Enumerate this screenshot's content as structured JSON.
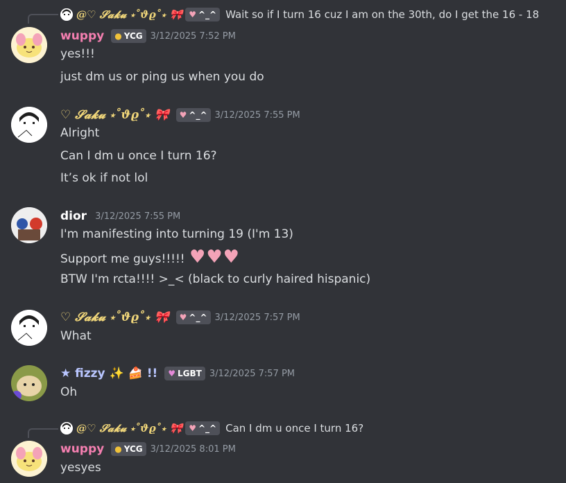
{
  "messages": [
    {
      "reply": {
        "author": "@♡ 𝓢𝓪𝓴𝓾 ⋆˚ϑϱ˚⋆ 🎀",
        "tag": "^_^",
        "text": "Wait so if I turn 16 cuz I am on the 30th, do I get the 16 - 18"
      },
      "author": "wuppy",
      "tag": "YCG",
      "timestamp": "3/12/2025 7:52 PM",
      "lines": [
        "yes!!!",
        "just dm us or ping us when you do"
      ]
    },
    {
      "author": "♡ 𝓢𝓪𝓴𝓾 ⋆˚ϑϱ˚⋆ 🎀",
      "tag": "^_^",
      "timestamp": "3/12/2025 7:55 PM",
      "lines": [
        "Alright",
        "Can I dm u once I turn 16?",
        "It’s ok if not lol"
      ]
    },
    {
      "author": "dior",
      "timestamp": "3/12/2025 7:55 PM",
      "lines": [
        "I'm manifesting into turning 19 (I'm 13)",
        "Support me guys!!!!!",
        "BTW I'm rcta!!!! >_< (black to curly haired hispanic)"
      ]
    },
    {
      "author": "♡ 𝓢𝓪𝓴𝓾 ⋆˚ϑϱ˚⋆ 🎀",
      "tag": "^_^",
      "timestamp": "3/12/2025 7:57 PM",
      "lines": [
        "What"
      ]
    },
    {
      "author": "★ fizzy ✨ 🍰 !!",
      "tag": "LGBT",
      "timestamp": "3/12/2025 7:57 PM",
      "lines": [
        "Oh"
      ]
    },
    {
      "reply": {
        "author": "@♡ 𝓢𝓪𝓴𝓾 ⋆˚ϑϱ˚⋆ 🎀",
        "tag": "^_^",
        "text": "Can I dm u once I turn 16?"
      },
      "author": "wuppy",
      "tag": "YCG",
      "timestamp": "3/12/2025 8:01 PM",
      "lines": [
        "yesyes"
      ]
    }
  ],
  "colors": {
    "wuppy": "#f47fb0",
    "saku": "#f0d67a",
    "dior": "#ffffff",
    "fizzy": "#b9c6ff"
  }
}
